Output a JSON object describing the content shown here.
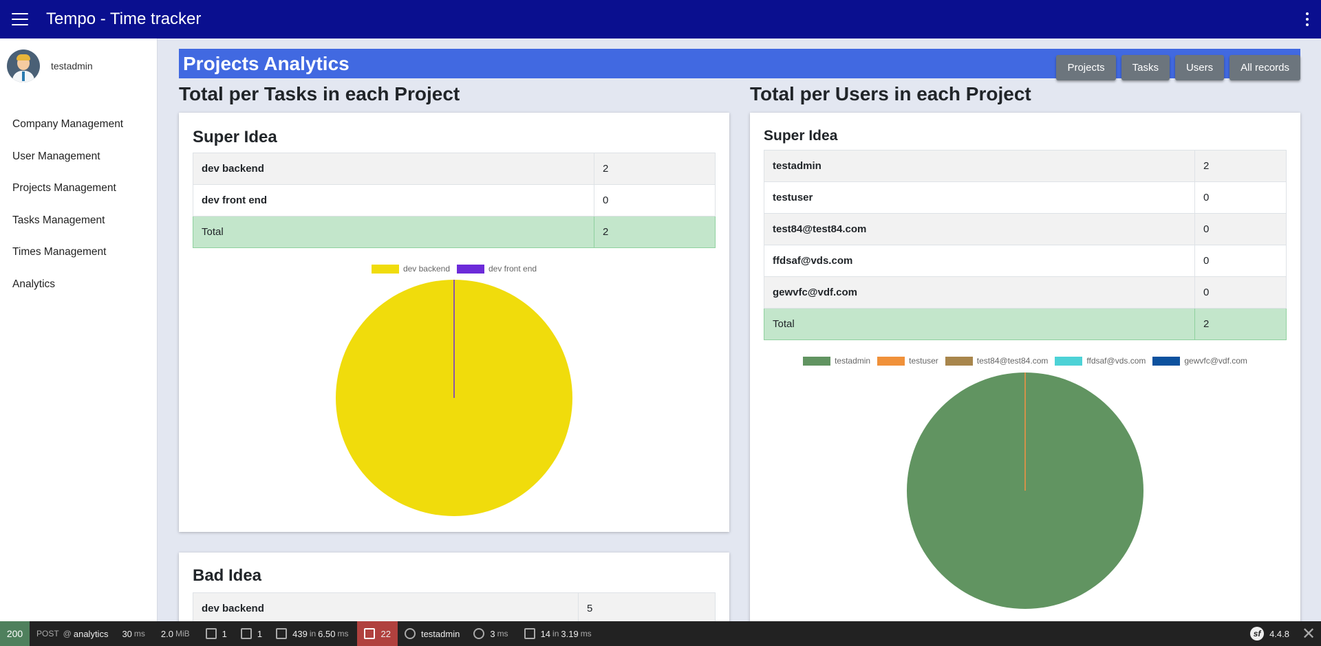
{
  "app": {
    "title": "Tempo - Time tracker"
  },
  "icons": {
    "menu": "hamburger-menu-icon",
    "more": "kebab-menu-icon",
    "avatar": "user-avatar"
  },
  "sidebar": {
    "username": "testadmin",
    "items": [
      {
        "label": "Company Management"
      },
      {
        "label": "User Management"
      },
      {
        "label": "Projects Management"
      },
      {
        "label": "Tasks Management"
      },
      {
        "label": "Times Management"
      },
      {
        "label": "Analytics"
      }
    ]
  },
  "header": {
    "title": "Projects Analytics",
    "buttons": [
      "Projects",
      "Tasks",
      "Users",
      "All records"
    ],
    "color": "#4169e1"
  },
  "tasks_section": {
    "title": "Total per Tasks in each Project",
    "projects": [
      {
        "name": "Super Idea",
        "rows": [
          {
            "label": "dev backend",
            "value": "2"
          },
          {
            "label": "dev front end",
            "value": "0"
          }
        ],
        "total_label": "Total",
        "total_value": "2",
        "legend": [
          {
            "label": "dev backend",
            "color": "#f0dc0c"
          },
          {
            "label": "dev front end",
            "color": "#6c2bd9"
          }
        ]
      },
      {
        "name": "Bad Idea",
        "rows": [
          {
            "label": "dev backend",
            "value": "5"
          }
        ]
      }
    ]
  },
  "users_section": {
    "title": "Total per Users in each Project",
    "projects": [
      {
        "name": "Super Idea",
        "rows": [
          {
            "label": "testadmin",
            "value": "2"
          },
          {
            "label": "testuser",
            "value": "0"
          },
          {
            "label": "test84@test84.com",
            "value": "0"
          },
          {
            "label": "ffdsaf@vds.com",
            "value": "0"
          },
          {
            "label": "gewvfc@vdf.com",
            "value": "0"
          }
        ],
        "total_label": "Total",
        "total_value": "2",
        "legend": [
          {
            "label": "testadmin",
            "color": "#619461"
          },
          {
            "label": "testuser",
            "color": "#f0913a"
          },
          {
            "label": "test84@test84.com",
            "color": "#a8864c"
          },
          {
            "label": "ffdsaf@vds.com",
            "color": "#4dd2d6"
          },
          {
            "label": "gewvfc@vdf.com",
            "color": "#0c519e"
          }
        ]
      }
    ]
  },
  "chart_data": [
    {
      "type": "pie",
      "categories": [
        "dev backend",
        "dev front end"
      ],
      "values": [
        2,
        0
      ],
      "legend_position": "top"
    },
    {
      "type": "pie",
      "categories": [
        "testadmin",
        "testuser",
        "test84@test84.com",
        "ffdsaf@vds.com",
        "gewvfc@vdf.com"
      ],
      "values": [
        2,
        0,
        0,
        0,
        0
      ],
      "legend_position": "top"
    }
  ],
  "toolbar": {
    "status": "200",
    "method": "POST",
    "route_at": "@",
    "route": "analytics",
    "time": "30",
    "time_unit": "ms",
    "memory": "2.0",
    "memory_unit": "MiB",
    "validator_count": "1",
    "forms_count": "1",
    "cache_count": "439",
    "cache_in": "in",
    "cache_time": "6.50",
    "cache_unit": "ms",
    "translation_count": "22",
    "user": "testadmin",
    "twig_time": "3",
    "twig_unit": "ms",
    "db_count": "14",
    "db_in": "in",
    "db_time": "3.19",
    "db_unit": "ms",
    "version": "4.4.8",
    "logo_letter": "sf"
  }
}
